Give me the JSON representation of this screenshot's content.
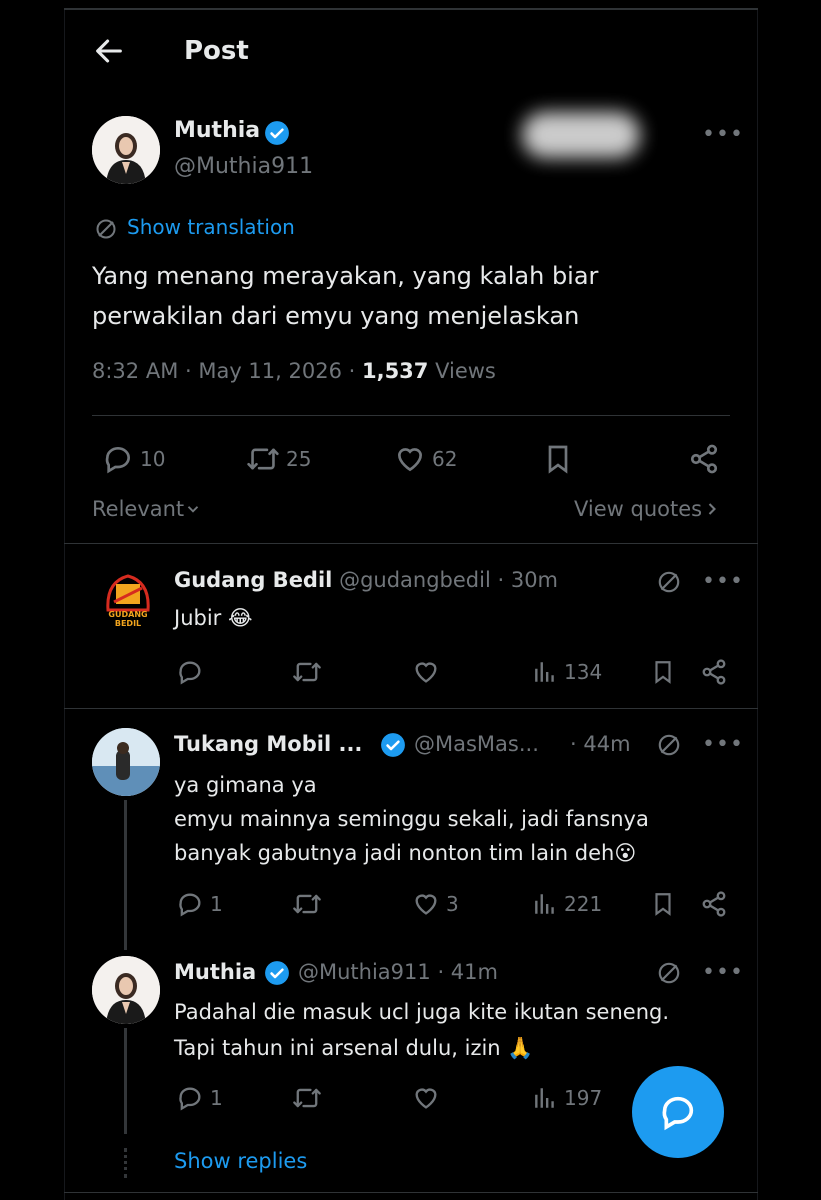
{
  "header": {
    "title": "Post"
  },
  "post": {
    "name": "Muthia",
    "handle": "@Muthia911",
    "translation_label": "Show translation",
    "text_line1": "Yang menang merayakan, yang kalah biar",
    "text_line2": "perwakilan dari emyu yang menjelaskan",
    "time": "8:32 AM · May 11, 2026 · ",
    "views_count": "1,537",
    "views_label": " Views",
    "replies": "10",
    "reposts": "25",
    "likes": "62"
  },
  "sort": {
    "label": "Relevant",
    "quotes_label": "View quotes"
  },
  "replies": [
    {
      "name": "Gudang Bedil",
      "handle": "@gudangbedil",
      "time": "· 30m",
      "text": "Jubir",
      "emoji": "😂",
      "avatar_text_1": "GUDANG",
      "avatar_text_2": "BEDIL",
      "reply_count": "",
      "like_count": "",
      "views": "134"
    },
    {
      "name": "Tukang Mobil ...",
      "handle": "@MasMas...",
      "time": "· 44m",
      "text_line1": "ya gimana ya",
      "text_line2": "emyu mainnya seminggu sekali, jadi fansnya",
      "text_line3": "banyak gabutnya jadi nonton tim lain deh",
      "emoji": "😮",
      "reply_count": "1",
      "like_count": "3",
      "views": "221"
    },
    {
      "name": "Muthia",
      "handle": "@Muthia911",
      "time": "· 41m",
      "text_line1": "Padahal die masuk ucl juga kite ikutan seneng.",
      "text_line2": "Tapi tahun ini arsenal dulu, izin",
      "emoji": "🙏",
      "reply_count": "1",
      "like_count": "",
      "views": "197"
    }
  ],
  "show_replies_label": "Show replies",
  "colors": {
    "background": "#000000",
    "text": "#e7e9ea",
    "muted": "#71767b",
    "accent": "#1d9bf0",
    "divider": "#2f3336"
  },
  "icons": [
    "back-arrow-icon",
    "verified-icon",
    "more-icon",
    "translate-icon",
    "reply-icon",
    "repost-icon",
    "like-icon",
    "bookmark-icon",
    "share-icon",
    "views-icon",
    "chevron-down-icon",
    "chevron-right-icon",
    "compose-reply-icon"
  ]
}
